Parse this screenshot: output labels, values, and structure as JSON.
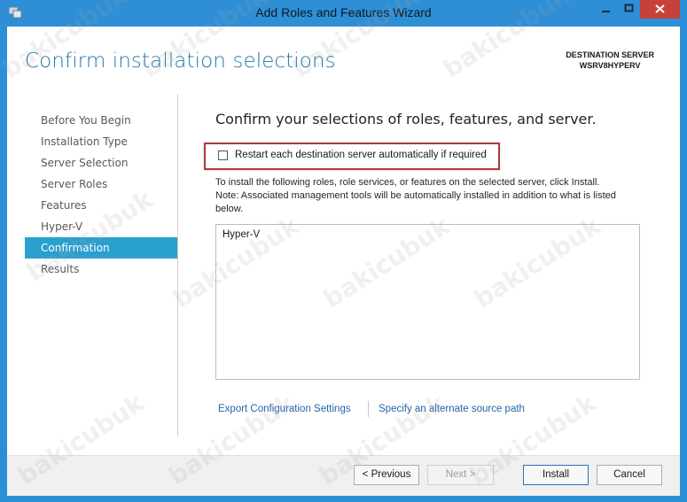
{
  "window": {
    "title": "Add Roles and Features Wizard"
  },
  "header": {
    "title": "Confirm installation selections",
    "destination_label": "DESTINATION SERVER",
    "destination_server": "WSRV8HYPERV"
  },
  "nav": {
    "items": [
      {
        "label": "Before You Begin",
        "active": false
      },
      {
        "label": "Installation Type",
        "active": false
      },
      {
        "label": "Server Selection",
        "active": false
      },
      {
        "label": "Server Roles",
        "active": false
      },
      {
        "label": "Features",
        "active": false
      },
      {
        "label": "Hyper-V",
        "active": false
      },
      {
        "label": "Confirmation",
        "active": true
      },
      {
        "label": "Results",
        "active": false
      }
    ]
  },
  "main": {
    "heading": "Confirm your selections of roles, features, and server.",
    "restart_checkbox": {
      "label": "Restart each destination server automatically if required",
      "checked": false
    },
    "info_line1": "To install the following roles, role services, or features on the selected server, click Install.",
    "info_line2": "Note: Associated management tools will be automatically installed in addition to what is listed below.",
    "selections": [
      "Hyper-V"
    ],
    "export_link": "Export Configuration Settings",
    "source_link": "Specify an alternate source path"
  },
  "footer": {
    "previous_label": "< Previous",
    "next_label": "Next >",
    "install_label": "Install",
    "cancel_label": "Cancel"
  },
  "watermark": {
    "text": "bakicubuk"
  },
  "colors": {
    "titlebar": "#2f8fd6",
    "accent": "#2aa0cf",
    "header_text": "#2377a8",
    "close_button": "#c7413b",
    "highlight_border": "#b03a3a",
    "link": "#2366a8"
  }
}
